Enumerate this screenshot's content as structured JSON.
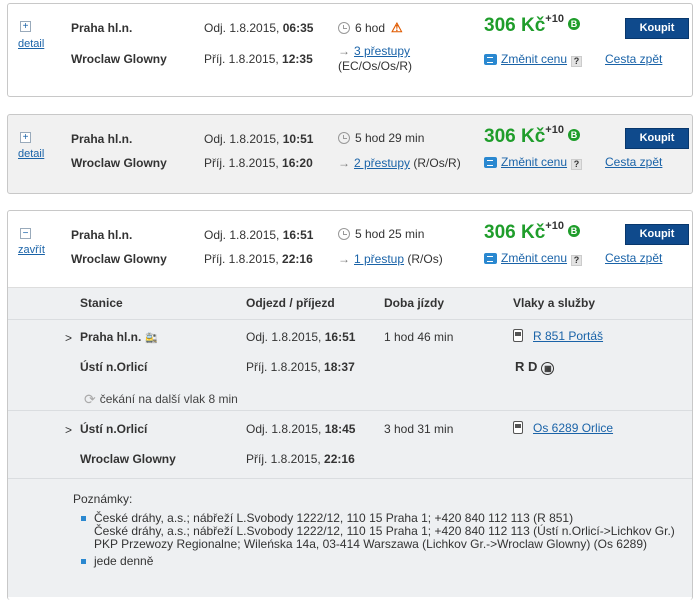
{
  "colors": {
    "accent": "#0f4a8c",
    "price": "#1f9d2b",
    "link": "#1a63a8",
    "warning": "#e05a00"
  },
  "connections": [
    {
      "toggle": "+",
      "toggle_label": "detail",
      "from": "Praha hl.n.",
      "to": "Wroclaw Glowny",
      "dep_label": "Odj. 1.8.2015, ",
      "dep_time": "06:35",
      "arr_label": "Příj. 1.8.2015, ",
      "arr_time": "12:35",
      "duration": "6 hod",
      "transfers": "3 přestupy",
      "train_types": "(EC/Os/Os/R)",
      "price": "306 Kč",
      "price_plus": "+10",
      "badge": "B",
      "buy": "Koupit",
      "change_price": "Změnit cenu",
      "help": "?",
      "return": "Cesta zpět"
    },
    {
      "toggle": "+",
      "toggle_label": "detail",
      "from": "Praha hl.n.",
      "to": "Wroclaw Glowny",
      "dep_label": "Odj. 1.8.2015, ",
      "dep_time": "10:51",
      "arr_label": "Příj. 1.8.2015, ",
      "arr_time": "16:20",
      "duration": "5 hod 29 min",
      "transfers": "2 přestupy",
      "train_types": " (R/Os/R)",
      "price": "306 Kč",
      "price_plus": "+10",
      "badge": "B",
      "buy": "Koupit",
      "change_price": "Změnit cenu",
      "help": "?",
      "return": "Cesta zpět"
    },
    {
      "toggle": "−",
      "toggle_label": "zavřít",
      "from": "Praha hl.n.",
      "to": "Wroclaw Glowny",
      "dep_label": "Odj. 1.8.2015, ",
      "dep_time": "16:51",
      "arr_label": "Příj. 1.8.2015, ",
      "arr_time": "22:16",
      "duration": "5 hod 25 min",
      "transfers": "1 přestup",
      "train_types": " (R/Os)",
      "price": "306 Kč",
      "price_plus": "+10",
      "badge": "B",
      "buy": "Koupit",
      "change_price": "Změnit cenu",
      "help": "?",
      "return": "Cesta zpět"
    }
  ],
  "detail": {
    "headers": {
      "station": "Stanice",
      "times": "Odjezd / příjezd",
      "duration": "Doba jízdy",
      "trains": "Vlaky a služby"
    },
    "legs": [
      {
        "marker": ">",
        "from": "Praha hl.n.",
        "dep_label": "Odj. 1.8.2015, ",
        "dep_time": "16:51",
        "to": "Ústí n.Orlicí",
        "arr_label": "Příj. 1.8.2015, ",
        "arr_time": "18:37",
        "duration": "1 hod 46 min",
        "train": "R 851 Portáš",
        "services": "R D"
      },
      {
        "marker": ">",
        "from": "Ústí n.Orlicí",
        "dep_label": "Odj. 1.8.2015, ",
        "dep_time": "18:45",
        "to": "Wroclaw Glowny",
        "arr_label": "Příj. 1.8.2015, ",
        "arr_time": "22:16",
        "duration": "3 hod 31 min",
        "train": "Os 6289 Orlice"
      }
    ],
    "wait": "čekání na další vlak 8 min",
    "notes_title": "Poznámky:",
    "notes": [
      [
        "České dráhy, a.s.; nábřeží L.Svobody 1222/12, 110 15 Praha 1; +420 840 112 113 (R 851)",
        "České dráhy, a.s.; nábřeží L.Svobody 1222/12, 110 15 Praha 1; +420 840 112 113 (Ústí n.Orlicí->Lichkov Gr.)",
        "PKP Przewozy Regionalne; Wileńska 14a, 03-414 Warszawa (Lichkov Gr.->Wroclaw Glowny) (Os 6289)"
      ],
      [
        "jede denně"
      ]
    ]
  }
}
